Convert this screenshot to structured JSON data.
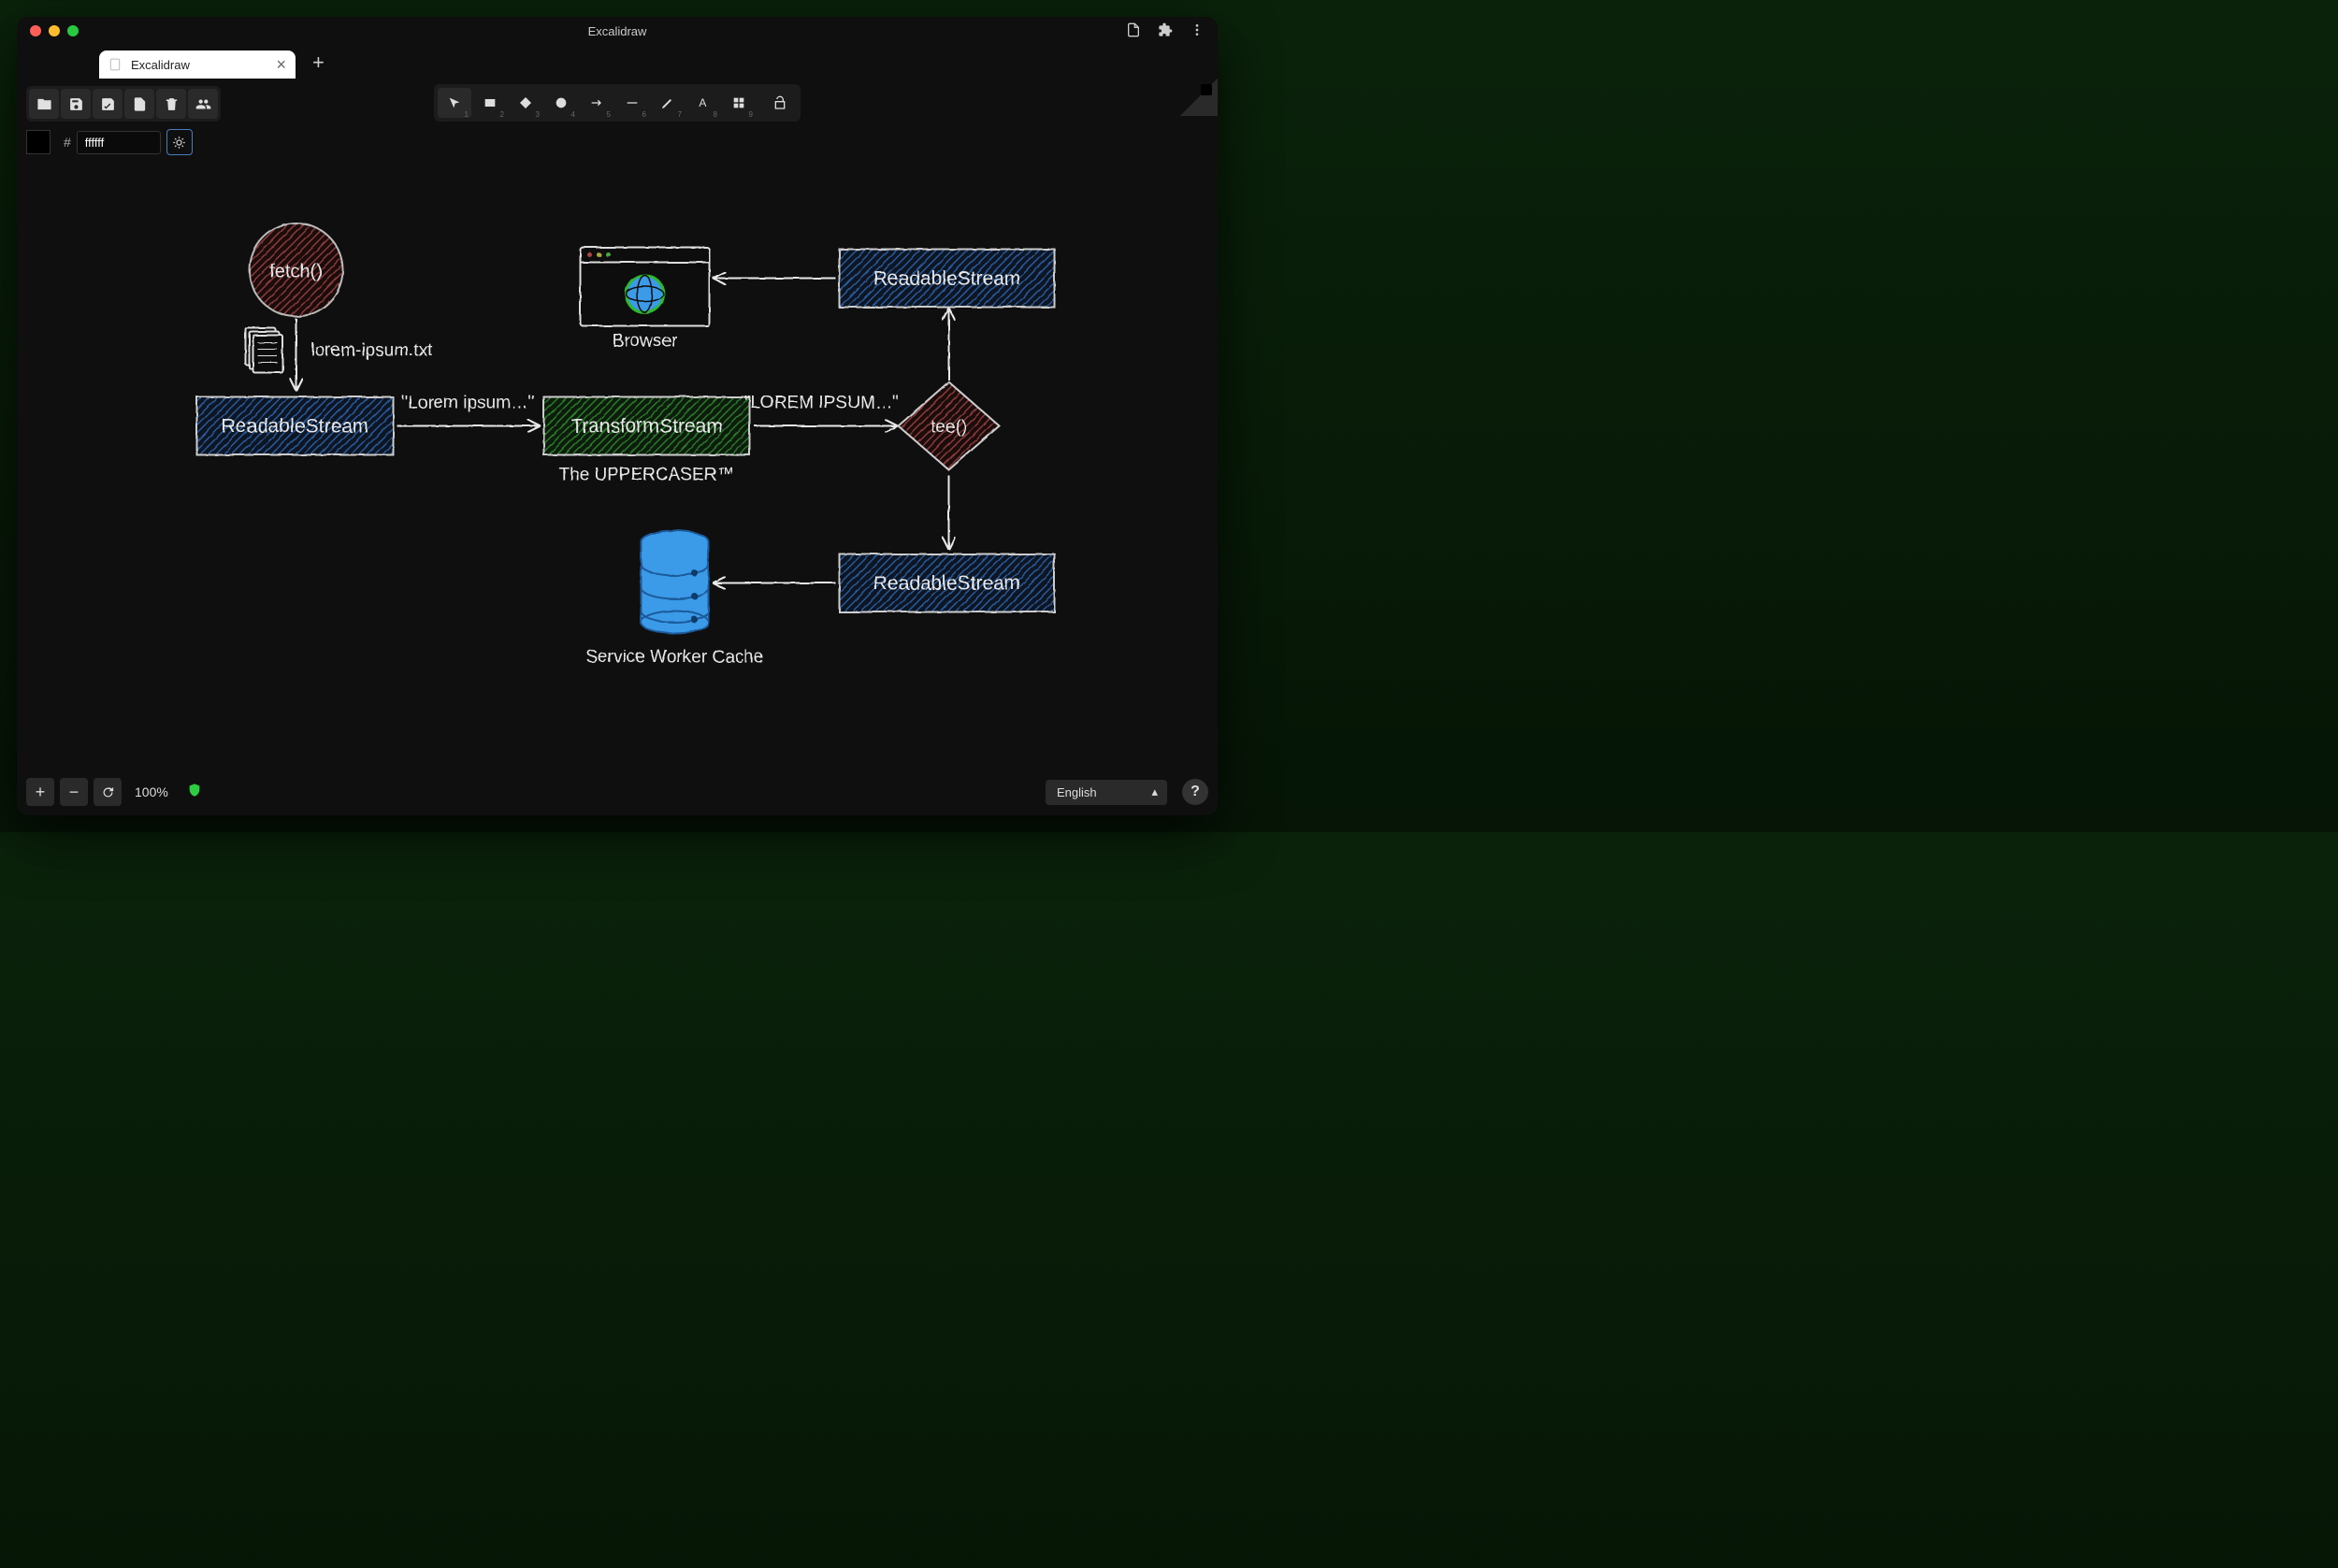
{
  "window": {
    "title": "Excalidraw"
  },
  "tab": {
    "label": "Excalidraw"
  },
  "hex": {
    "value": "ffffff"
  },
  "zoom": {
    "label": "100%"
  },
  "language": {
    "value": "English"
  },
  "tools": {
    "n1": "1",
    "n2": "2",
    "n3": "3",
    "n4": "4",
    "n5": "5",
    "n6": "6",
    "n7": "7",
    "n8": "8",
    "n9": "9"
  },
  "diagram": {
    "fetch": "fetch()",
    "file": "lorem-ipsum.txt",
    "rs1": "ReadableStream",
    "edge1": "\"Lorem ipsum…\"",
    "transform": "TransformStream",
    "transform_sub": "The UPPERCASER™",
    "edge2": "\"LOREM IPSUM…\"",
    "tee": "tee()",
    "rs2": "ReadableStream",
    "browser": "Browser",
    "rs3": "ReadableStream",
    "cache": "Service Worker Cache"
  }
}
